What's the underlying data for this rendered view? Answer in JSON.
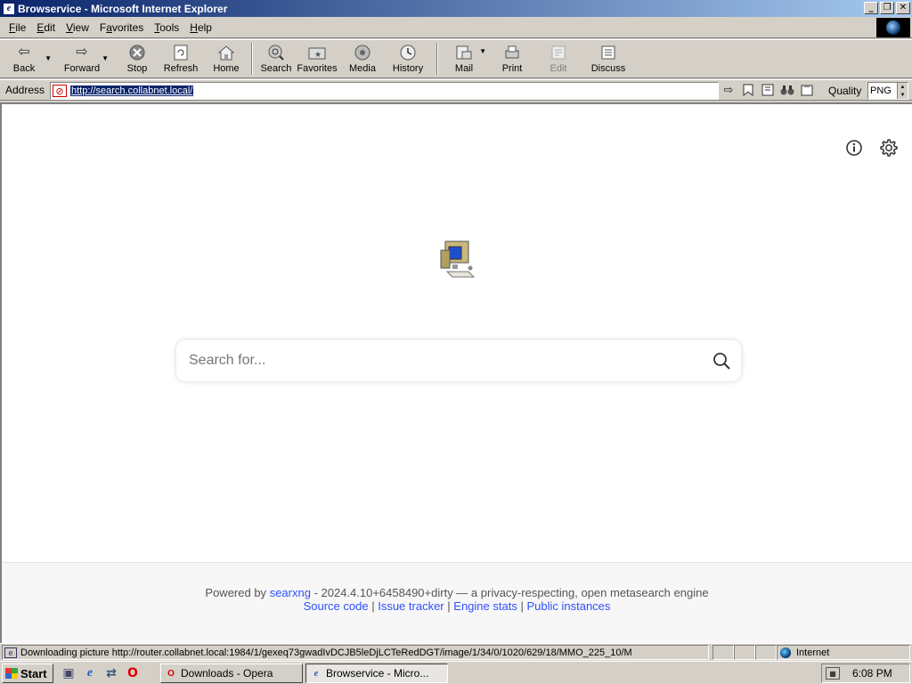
{
  "window": {
    "title": "Browservice - Microsoft Internet Explorer",
    "controls": {
      "minimize": "_",
      "restore": "❐",
      "close": "✕"
    }
  },
  "menu": {
    "items": [
      {
        "label": "File",
        "accel": "F",
        "rest": "ile"
      },
      {
        "label": "Edit",
        "accel": "E",
        "rest": "dit"
      },
      {
        "label": "View",
        "accel": "V",
        "rest": "iew"
      },
      {
        "label": "Favorites",
        "accel": "a",
        "pre": "F",
        "rest": "vorites"
      },
      {
        "label": "Tools",
        "accel": "T",
        "rest": "ools"
      },
      {
        "label": "Help",
        "accel": "H",
        "rest": "elp"
      }
    ]
  },
  "toolbar": {
    "back": "Back",
    "forward": "Forward",
    "stop": "Stop",
    "refresh": "Refresh",
    "home": "Home",
    "search": "Search",
    "favorites": "Favorites",
    "media": "Media",
    "history": "History",
    "mail": "Mail",
    "print": "Print",
    "edit": "Edit",
    "discuss": "Discuss"
  },
  "address": {
    "label": "Address",
    "url": "http://search.collabnet.local/",
    "quality_label": "Quality",
    "quality_value": "PNG"
  },
  "page": {
    "search_placeholder": "Search for...",
    "footer": {
      "powered_by": "Powered by",
      "engine_name": "searxng",
      "version_text": "- 2024.4.10+6458490+dirty — a privacy-respecting, open metasearch engine",
      "links": [
        "Source code",
        "Issue tracker",
        "Engine stats",
        "Public instances"
      ],
      "separator": "|"
    }
  },
  "statusbar": {
    "text": "Downloading picture http://router.collabnet.local:1984/1/gexeq73gwadIvDCJB5leDjLCTeRedDGT/image/1/34/0/1020/629/18/MMO_225_10/M",
    "zone": "Internet"
  },
  "taskbar": {
    "start": "Start",
    "tasks": [
      {
        "label": "Downloads - Opera",
        "active": false
      },
      {
        "label": "Browservice - Micro...",
        "active": true
      }
    ],
    "clock": "6:08 PM"
  },
  "colors": {
    "titlebar_start": "#0a246a",
    "titlebar_end": "#a6caf0",
    "link": "#3050ff",
    "chrome": "#d4d0c8"
  }
}
